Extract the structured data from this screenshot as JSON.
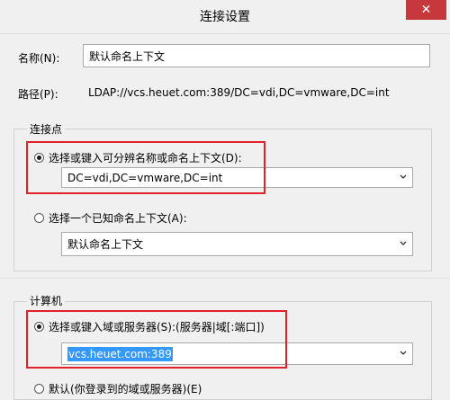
{
  "window": {
    "title": "连接设置",
    "close_glyph": "✕"
  },
  "name_field": {
    "label": "名称(N):",
    "value": "默认命名上下文"
  },
  "path_field": {
    "label": "路径(P):",
    "value": "LDAP://vcs.heuet.com:389/DC=vdi,DC=vmware,DC=int"
  },
  "connection_point": {
    "title": "连接点",
    "option_distinguished": {
      "label": "选择或键入可分辨名称或命名上下文(D):",
      "checked": true
    },
    "dn_combo": {
      "value": "DC=vdi,DC=vmware,DC=int"
    },
    "option_known": {
      "label": "选择一个已知命名上下文(A):",
      "checked": false
    },
    "known_combo": {
      "value": "默认命名上下文"
    }
  },
  "computer": {
    "title": "计算机",
    "option_domain": {
      "label": "选择或键入域或服务器(S):(服务器|域[:端口])",
      "checked": true
    },
    "server_combo": {
      "value": "vcs.heuet.com:389"
    },
    "option_default": {
      "label": "默认(你登录到的域或服务器)(E)",
      "checked": false
    }
  },
  "colors": {
    "highlight": "#e0212b",
    "selection": "#3399ff",
    "close": "#c7383c"
  }
}
